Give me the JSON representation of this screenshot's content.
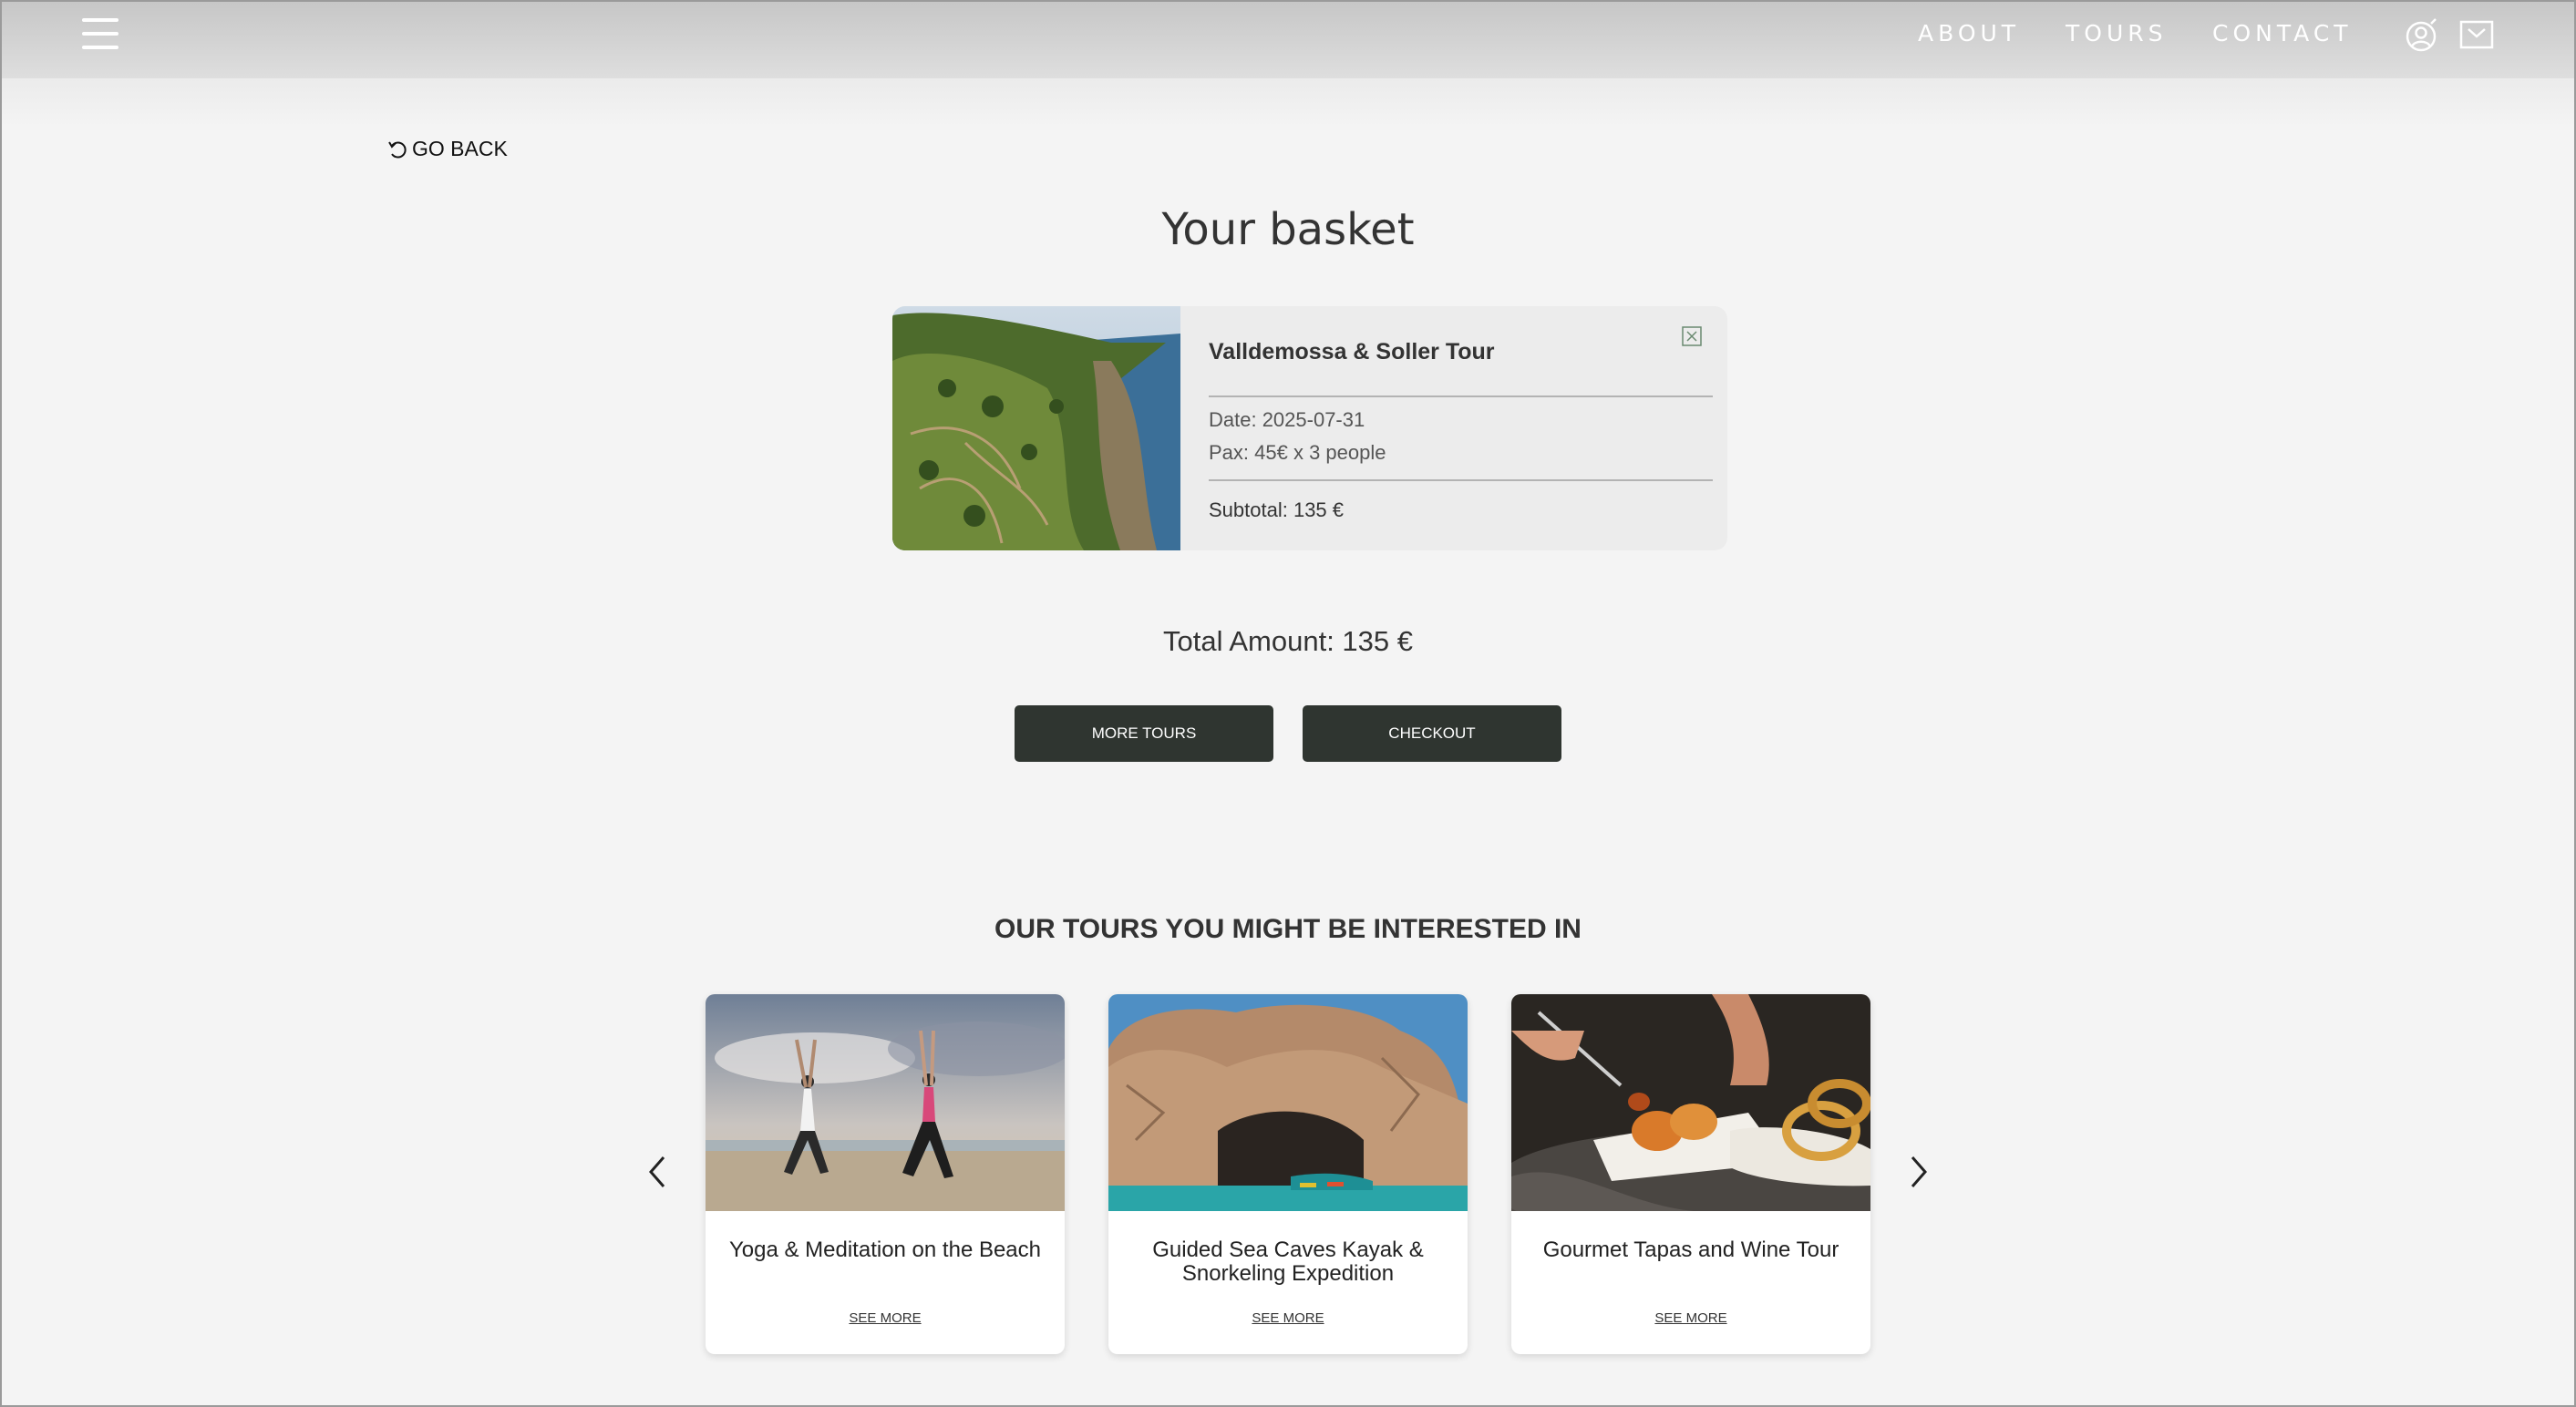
{
  "header": {
    "nav": [
      "ABOUT",
      "TOURS",
      "CONTACT"
    ],
    "icons": [
      "menu-icon",
      "user-icon",
      "cart-icon"
    ]
  },
  "go_back": "GO BACK",
  "page_title": "Your basket",
  "basket": {
    "items": [
      {
        "name": "Valldemossa & Soller Tour",
        "date": "Date: 2025-07-31",
        "pax": "Pax: 45€ x 3 people",
        "subtotal": "Subtotal: 135 €"
      }
    ],
    "total": "Total Amount: 135 €"
  },
  "buttons": {
    "more_tours": "MORE TOURS",
    "checkout": "CHECKOUT"
  },
  "recommended": {
    "title": "OUR TOURS YOU MIGHT BE INTERESTED IN",
    "tours": [
      {
        "title": "Yoga & Meditation on the Beach",
        "cta": "SEE MORE"
      },
      {
        "title": "Guided Sea Caves Kayak & Snorkeling Expedition",
        "cta": "SEE MORE"
      },
      {
        "title": "Gourmet Tapas and Wine Tour",
        "cta": "SEE MORE"
      }
    ]
  },
  "colors": {
    "button_bg": "#2f3530",
    "page_bg": "#f4f4f4",
    "card_bg": "#ececec"
  }
}
